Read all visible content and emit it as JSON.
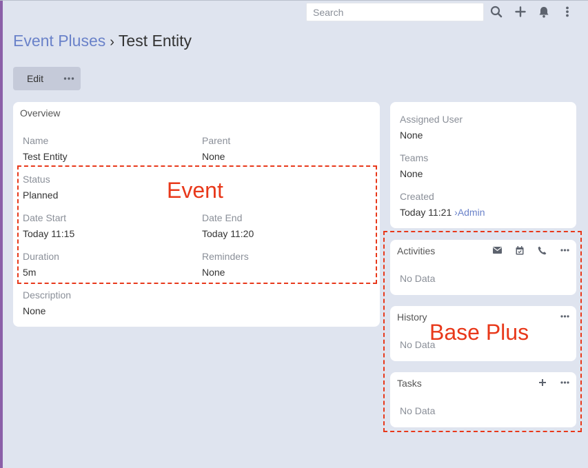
{
  "header": {
    "search_placeholder": "Search",
    "icons": [
      "search-icon",
      "plus-icon",
      "bell-icon",
      "kebab-menu-icon"
    ]
  },
  "breadcrumb": {
    "parent": "Event Pluses",
    "separator": "›",
    "current": "Test Entity"
  },
  "actions": {
    "edit_label": "Edit",
    "more_icon": "ellipsis-icon"
  },
  "overview": {
    "title": "Overview",
    "fields": {
      "name": {
        "label": "Name",
        "value": "Test Entity"
      },
      "parent": {
        "label": "Parent",
        "value": "None"
      },
      "status": {
        "label": "Status",
        "value": "Planned"
      },
      "date_start": {
        "label": "Date Start",
        "value": "Today 11:15"
      },
      "date_end": {
        "label": "Date End",
        "value": "Today 11:20"
      },
      "duration": {
        "label": "Duration",
        "value": "5m"
      },
      "reminders": {
        "label": "Reminders",
        "value": "None"
      },
      "description": {
        "label": "Description",
        "value": "None"
      }
    }
  },
  "side_info": {
    "assigned_user": {
      "label": "Assigned User",
      "value": "None"
    },
    "teams": {
      "label": "Teams",
      "value": "None"
    },
    "created": {
      "label": "Created",
      "value": "Today 11:21",
      "separator": "›",
      "by": "Admin"
    }
  },
  "activities": {
    "title": "Activities",
    "empty": "No Data",
    "icons": [
      "envelope-icon",
      "calendar-icon",
      "phone-icon",
      "ellipsis-icon"
    ]
  },
  "history": {
    "title": "History",
    "empty": "No Data"
  },
  "tasks": {
    "title": "Tasks",
    "empty": "No Data"
  },
  "annotations": {
    "event_label": "Event",
    "base_plus_label": "Base Plus",
    "color": "#e8381a"
  },
  "colors": {
    "background": "#dfe4ef",
    "link": "#6a82c9",
    "button": "#c5cad9",
    "sidebar_accent": "#8b5fa8"
  }
}
